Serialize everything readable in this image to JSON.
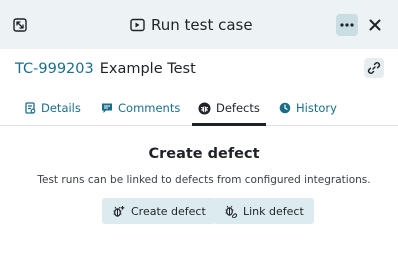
{
  "header": {
    "title": "Run test case",
    "icons": {
      "expand": "expand-icon",
      "title": "test-case-icon",
      "more": "more-icon",
      "close": "close-icon"
    }
  },
  "test_case": {
    "id": "TC-999203",
    "name": "Example Test",
    "link_icon": "link-icon"
  },
  "tabs": [
    {
      "label": "Details",
      "icon": "details-icon",
      "active": false
    },
    {
      "label": "Comments",
      "icon": "comments-icon",
      "active": false
    },
    {
      "label": "Defects",
      "icon": "bug-icon",
      "active": true
    },
    {
      "label": "History",
      "icon": "history-icon",
      "active": false
    }
  ],
  "defects": {
    "title": "Create defect",
    "description": "Test runs can be linked to defects from configured integrations.",
    "create_label": "Create defect",
    "link_label": "Link defect"
  },
  "colors": {
    "accent": "#1a6e8a",
    "header_bg": "#edf3f5",
    "button_bg": "#dcebef",
    "text": "#1f2328"
  }
}
